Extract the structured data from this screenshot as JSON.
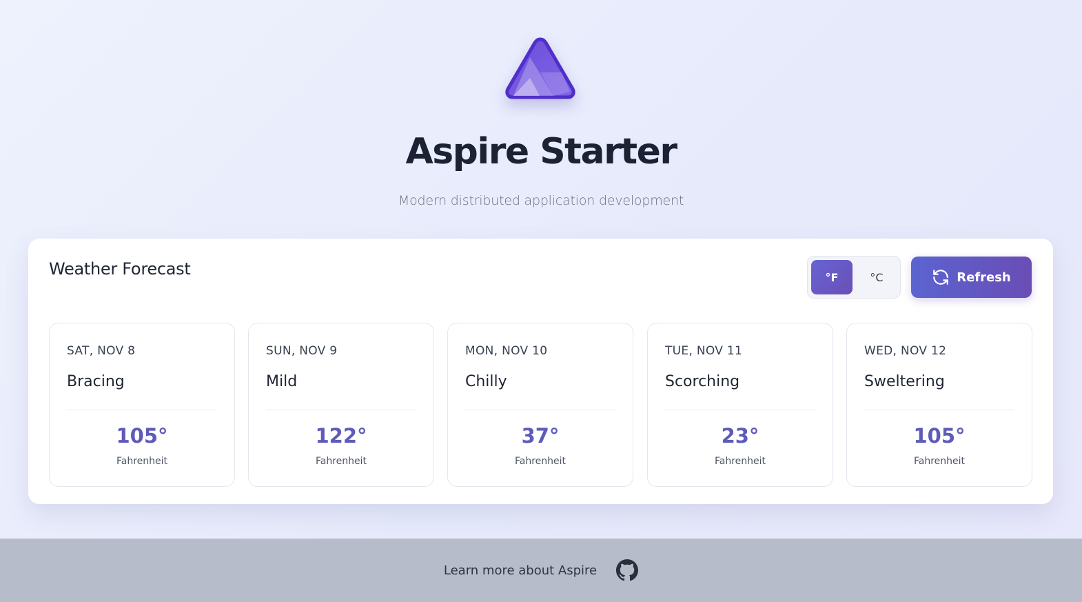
{
  "header": {
    "title": "Aspire Starter",
    "subtitle": "Modern distributed application development",
    "logo_icon": "aspire-logo-icon"
  },
  "weather": {
    "title": "Weather Forecast",
    "unit_toggle": {
      "fahrenheit_label": "°F",
      "celsius_label": "°C",
      "selected": "°F"
    },
    "refresh_label": "Refresh",
    "refresh_icon": "refresh-icon",
    "forecasts": [
      {
        "date": "SAT, NOV 8",
        "summary": "Bracing",
        "temp": "105°",
        "unit": "Fahrenheit"
      },
      {
        "date": "SUN, NOV 9",
        "summary": "Mild",
        "temp": "122°",
        "unit": "Fahrenheit"
      },
      {
        "date": "MON, NOV 10",
        "summary": "Chilly",
        "temp": "37°",
        "unit": "Fahrenheit"
      },
      {
        "date": "TUE, NOV 11",
        "summary": "Scorching",
        "temp": "23°",
        "unit": "Fahrenheit"
      },
      {
        "date": "WED, NOV 12",
        "summary": "Sweltering",
        "temp": "105°",
        "unit": "Fahrenheit"
      }
    ]
  },
  "footer": {
    "link_label": "Learn more about Aspire",
    "github_icon": "github-icon"
  },
  "colors": {
    "accent": "#6a5cc8",
    "temp_text": "#5f5bb8",
    "footer_bg": "#b7bccb"
  }
}
